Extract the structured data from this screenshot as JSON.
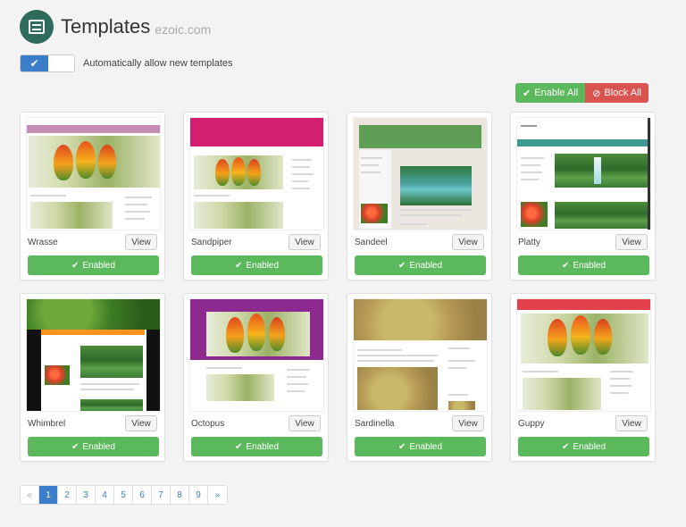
{
  "header": {
    "title": "Templates",
    "subtitle": "ezoic.com",
    "logo_icon": "server-icon"
  },
  "auto_allow": {
    "label": "Automatically allow new templates",
    "checked": true,
    "check_glyph": "✔"
  },
  "bulk": {
    "enable_all": "Enable All",
    "block_all": "Block All"
  },
  "colors": {
    "accent": "#3b7dc8",
    "enabled": "#5cb85c",
    "block": "#d9534f",
    "logo": "#2f6b5c"
  },
  "templates": [
    {
      "name": "Wrasse",
      "view": "View",
      "status": "Enabled"
    },
    {
      "name": "Sandpiper",
      "view": "View",
      "status": "Enabled"
    },
    {
      "name": "Sandeel",
      "view": "View",
      "status": "Enabled"
    },
    {
      "name": "Platty",
      "view": "View",
      "status": "Enabled"
    },
    {
      "name": "Whimbrel",
      "view": "View",
      "status": "Enabled"
    },
    {
      "name": "Octopus",
      "view": "View",
      "status": "Enabled"
    },
    {
      "name": "Sardinella",
      "view": "View",
      "status": "Enabled"
    },
    {
      "name": "Guppy",
      "view": "View",
      "status": "Enabled"
    }
  ],
  "pagination": {
    "prev": "«",
    "next": "»",
    "pages": [
      "1",
      "2",
      "3",
      "4",
      "5",
      "6",
      "7",
      "8",
      "9"
    ],
    "current": "1"
  }
}
